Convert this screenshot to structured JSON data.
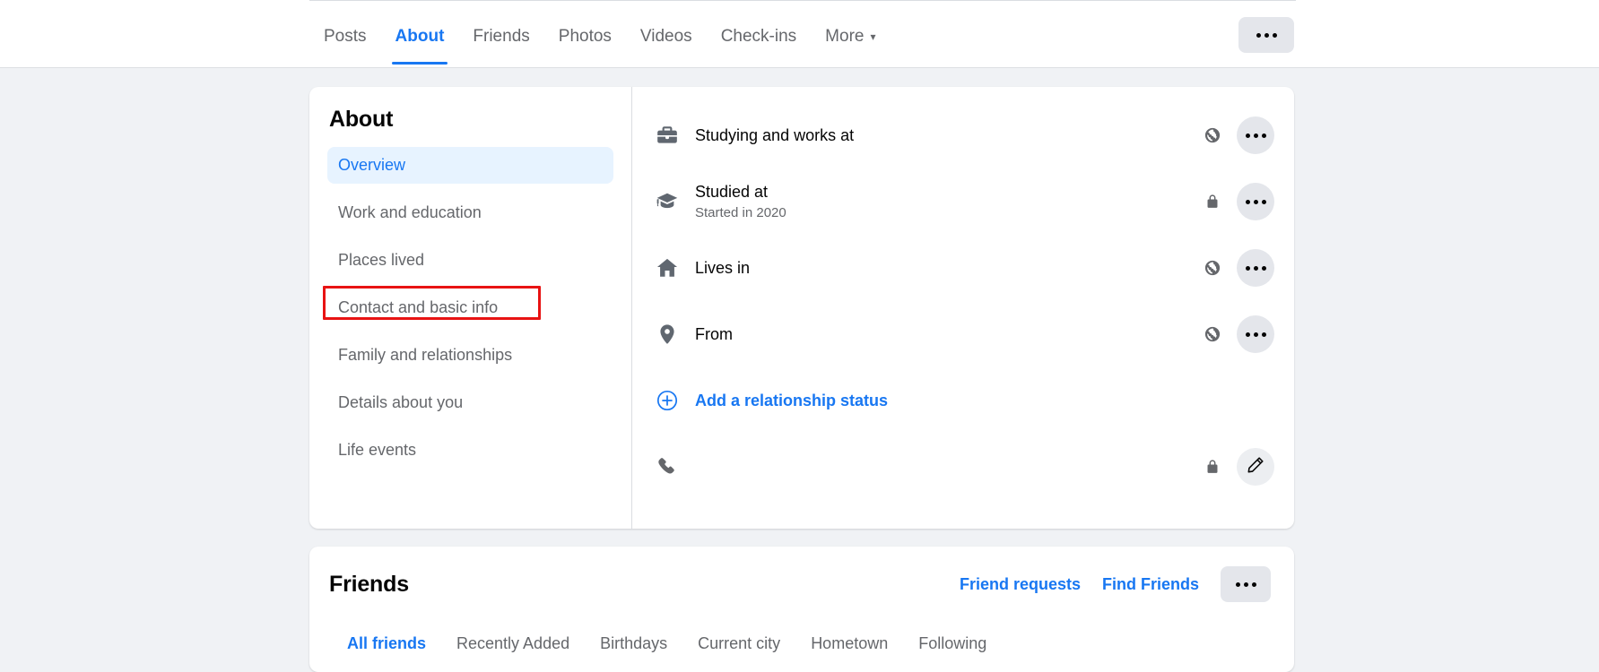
{
  "nav": {
    "tabs": [
      {
        "label": "Posts",
        "active": false,
        "caret": false
      },
      {
        "label": "About",
        "active": true,
        "caret": false
      },
      {
        "label": "Friends",
        "active": false,
        "caret": false
      },
      {
        "label": "Photos",
        "active": false,
        "caret": false
      },
      {
        "label": "Videos",
        "active": false,
        "caret": false
      },
      {
        "label": "Check-ins",
        "active": false,
        "caret": false
      },
      {
        "label": "More",
        "active": false,
        "caret": true
      }
    ],
    "caret_glyph": "▾",
    "more_button_label": "more-options"
  },
  "about": {
    "title": "About",
    "menu": [
      {
        "label": "Overview",
        "active": true,
        "highlighted": false
      },
      {
        "label": "Work and education",
        "active": false,
        "highlighted": false
      },
      {
        "label": "Places lived",
        "active": false,
        "highlighted": false
      },
      {
        "label": "Contact and basic info",
        "active": false,
        "highlighted": true
      },
      {
        "label": "Family and relationships",
        "active": false,
        "highlighted": false
      },
      {
        "label": "Details about you",
        "active": false,
        "highlighted": false
      },
      {
        "label": "Life events",
        "active": false,
        "highlighted": false
      }
    ],
    "rows": [
      {
        "icon": "briefcase-icon",
        "primary": "Studying and works at",
        "secondary": "",
        "privacy": "globe-icon",
        "action": "more-options-icon",
        "is_link": false
      },
      {
        "icon": "graduation-cap-icon",
        "primary": "Studied at",
        "secondary": "Started in 2020",
        "privacy": "lock-icon",
        "action": "more-options-icon",
        "is_link": false
      },
      {
        "icon": "home-icon",
        "primary": "Lives in",
        "secondary": "",
        "privacy": "globe-icon",
        "action": "more-options-icon",
        "is_link": false
      },
      {
        "icon": "location-pin-icon",
        "primary": "From",
        "secondary": "",
        "privacy": "globe-icon",
        "action": "more-options-icon",
        "is_link": false
      },
      {
        "icon": "plus-circle-icon",
        "primary": "Add a relationship status",
        "secondary": "",
        "privacy": "",
        "action": "",
        "is_link": true
      },
      {
        "icon": "phone-icon",
        "primary": "",
        "secondary": "",
        "privacy": "lock-icon",
        "action": "pencil-icon",
        "is_link": false
      }
    ]
  },
  "friends": {
    "title": "Friends",
    "links": [
      {
        "label": "Friend requests"
      },
      {
        "label": "Find Friends"
      }
    ],
    "more_button_label": "more-options",
    "tabs": [
      {
        "label": "All friends",
        "active": true
      },
      {
        "label": "Recently Added",
        "active": false
      },
      {
        "label": "Birthdays",
        "active": false
      },
      {
        "label": "Current city",
        "active": false
      },
      {
        "label": "Hometown",
        "active": false
      },
      {
        "label": "Following",
        "active": false
      }
    ]
  },
  "colors": {
    "accent": "#1877f2",
    "page_background": "#f0f2f5",
    "card_background": "#ffffff",
    "annotation_red": "#e81313",
    "muted_text": "#65676b"
  }
}
